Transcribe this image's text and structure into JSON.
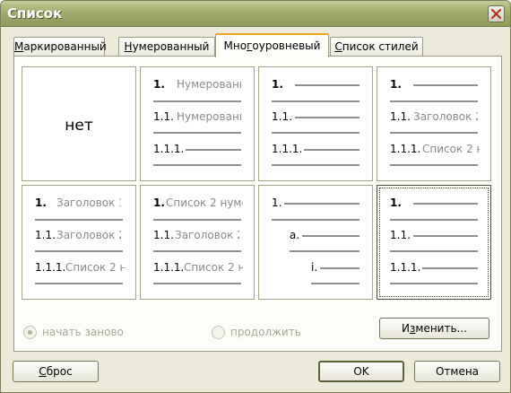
{
  "window": {
    "title": "Список"
  },
  "tabs": [
    {
      "label": "Маркированный",
      "pre": "",
      "ul": "М",
      "post": "аркированный"
    },
    {
      "label": "Нумерованный",
      "pre": "",
      "ul": "Н",
      "post": "умерованный"
    },
    {
      "label": "Многоуровневый",
      "pre": "Мно",
      "ul": "г",
      "post": "оуровневый"
    },
    {
      "label": "Список стилей",
      "pre": "",
      "ul": "С",
      "post": "писок стилей"
    }
  ],
  "active_tab": "Многоуровневый",
  "cells": {
    "none_label": "нет",
    "c2": {
      "r1n": "1.",
      "r1t": "Нумерованн",
      "r2n": "1.1.",
      "r2t": "Нумерованн",
      "r3n": "1.1.1."
    },
    "c3": {
      "r1n": "1.",
      "r2n": "1.1.",
      "r3n": "1.1.1."
    },
    "c4": {
      "r1n": "1.",
      "r2n": "1.1.",
      "r2t": "Заголовок 2",
      "r3n": "1.1.1.",
      "r3t": "Список 2 н"
    },
    "c5": {
      "r1n": "1.",
      "r1t": "Заголовок 1",
      "r2n": "1.1.",
      "r2t": "Заголовок 2",
      "r3n": "1.1.1.",
      "r3t": "Список 2 н"
    },
    "c6": {
      "r1n": "1.",
      "r1t": "Список 2 нуме",
      "r2n": "1.1.",
      "r2t": "Заголовок 2",
      "r3n": "1.1.1.",
      "r3t": "Список 2 н"
    },
    "c7": {
      "r1n": "1.",
      "r2n": "a.",
      "r3n": "i."
    },
    "c8": {
      "r1n": "1.",
      "r2n": "1.1.",
      "r3n": "1.1.1."
    }
  },
  "options": {
    "restart_label": "начать заново",
    "continue_label": "продолжить",
    "modify_pre": "И",
    "modify_ul": "з",
    "modify_post": "менить..."
  },
  "buttons": {
    "reset_pre": "",
    "reset_ul": "С",
    "reset_post": "брос",
    "ok_label": "OK",
    "cancel_label": "Отмена"
  }
}
